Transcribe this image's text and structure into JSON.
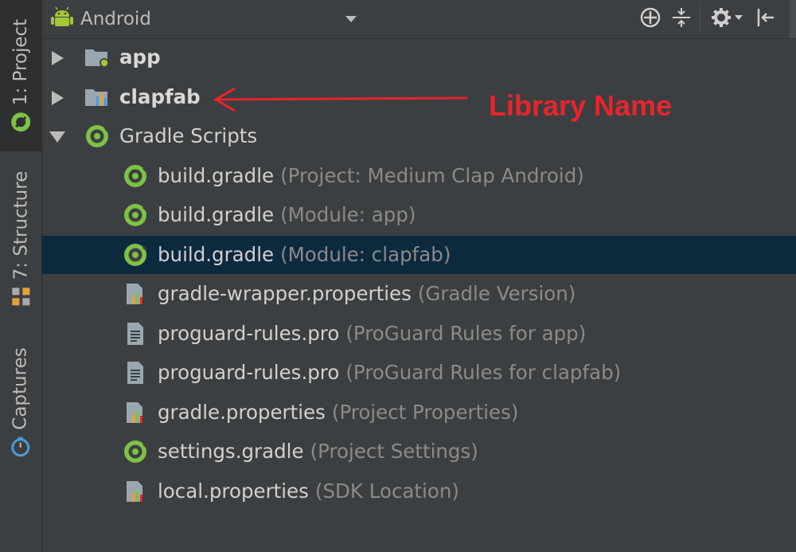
{
  "side_tabs": [
    {
      "label": "1: Project",
      "icon": "android-icon",
      "active": true
    },
    {
      "label": "7: Structure",
      "icon": "structure-icon",
      "active": false
    },
    {
      "label": "Captures",
      "icon": "captures-icon",
      "active": false
    }
  ],
  "toolbar": {
    "view_label": "Android",
    "view_icon": "android-icon",
    "buttons": [
      "crosshair-icon",
      "collapse-icon",
      "gear-icon",
      "hide-icon"
    ]
  },
  "tree": [
    {
      "name": "app",
      "hint": "",
      "icon": "module-folder-icon",
      "level": 0,
      "arrow": "collapsed",
      "bold": true
    },
    {
      "name": "clapfab",
      "hint": "",
      "icon": "library-module-icon",
      "level": 0,
      "arrow": "collapsed",
      "bold": true
    },
    {
      "name": "Gradle Scripts",
      "hint": "",
      "icon": "gradle-icon",
      "level": 0,
      "arrow": "expanded",
      "bold": false
    },
    {
      "name": "build.gradle",
      "hint": "(Project: Medium Clap Android)",
      "icon": "gradle-icon",
      "level": 1,
      "arrow": "",
      "bold": false
    },
    {
      "name": "build.gradle",
      "hint": "(Module: app)",
      "icon": "gradle-icon",
      "level": 1,
      "arrow": "",
      "bold": false
    },
    {
      "name": "build.gradle",
      "hint": "(Module: clapfab)",
      "icon": "gradle-icon",
      "level": 1,
      "arrow": "",
      "bold": false,
      "selected": true
    },
    {
      "name": "gradle-wrapper.properties",
      "hint": "(Gradle Version)",
      "icon": "properties-icon",
      "level": 1,
      "arrow": "",
      "bold": false
    },
    {
      "name": "proguard-rules.pro",
      "hint": "(ProGuard Rules for app)",
      "icon": "text-file-icon",
      "level": 1,
      "arrow": "",
      "bold": false
    },
    {
      "name": "proguard-rules.pro",
      "hint": "(ProGuard Rules for clapfab)",
      "icon": "text-file-icon",
      "level": 1,
      "arrow": "",
      "bold": false
    },
    {
      "name": "gradle.properties",
      "hint": "(Project Properties)",
      "icon": "properties-icon",
      "level": 1,
      "arrow": "",
      "bold": false
    },
    {
      "name": "settings.gradle",
      "hint": "(Project Settings)",
      "icon": "gradle-icon",
      "level": 1,
      "arrow": "",
      "bold": false
    },
    {
      "name": "local.properties",
      "hint": "(SDK Location)",
      "icon": "properties-icon",
      "level": 1,
      "arrow": "",
      "bold": false
    }
  ],
  "annotation": {
    "label": "Library Name",
    "color": "#e8242c"
  },
  "colors": {
    "selection": "#0d293e",
    "background": "#3c3f41",
    "gradle_green": "#7dc245"
  }
}
